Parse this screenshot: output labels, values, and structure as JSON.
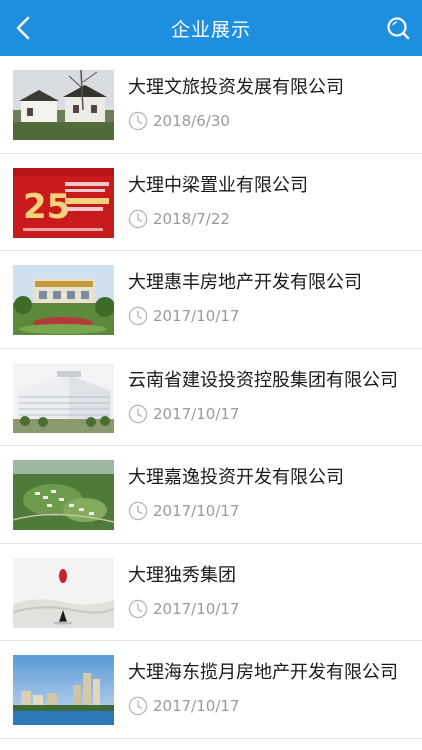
{
  "header": {
    "title": "企业展示",
    "back_icon": "chevron-left-icon",
    "search_icon": "search-icon",
    "background": "#1e8fe0"
  },
  "companies": [
    {
      "name": "大理文旅投资发展有限公司",
      "date": "2018/6/30",
      "thumb_icon": "building-photo"
    },
    {
      "name": "大理中梁置业有限公司",
      "date": "2018/7/22",
      "thumb_icon": "red-poster-photo",
      "thumb_text": "25"
    },
    {
      "name": "大理惠丰房地产开发有限公司",
      "date": "2017/10/17",
      "thumb_icon": "garden-building-photo"
    },
    {
      "name": "云南省建设投资控股集团有限公司",
      "date": "2017/10/17",
      "thumb_icon": "office-tower-photo"
    },
    {
      "name": "大理嘉逸投资开发有限公司",
      "date": "2017/10/17",
      "thumb_icon": "aerial-green-photo"
    },
    {
      "name": "大理独秀集团",
      "date": "2017/10/17",
      "thumb_icon": "ink-landscape-photo"
    },
    {
      "name": "大理海东揽月房地产开发有限公司",
      "date": "2017/10/17",
      "thumb_icon": "lakeside-city-photo"
    }
  ],
  "clock_icon": "clock-icon"
}
